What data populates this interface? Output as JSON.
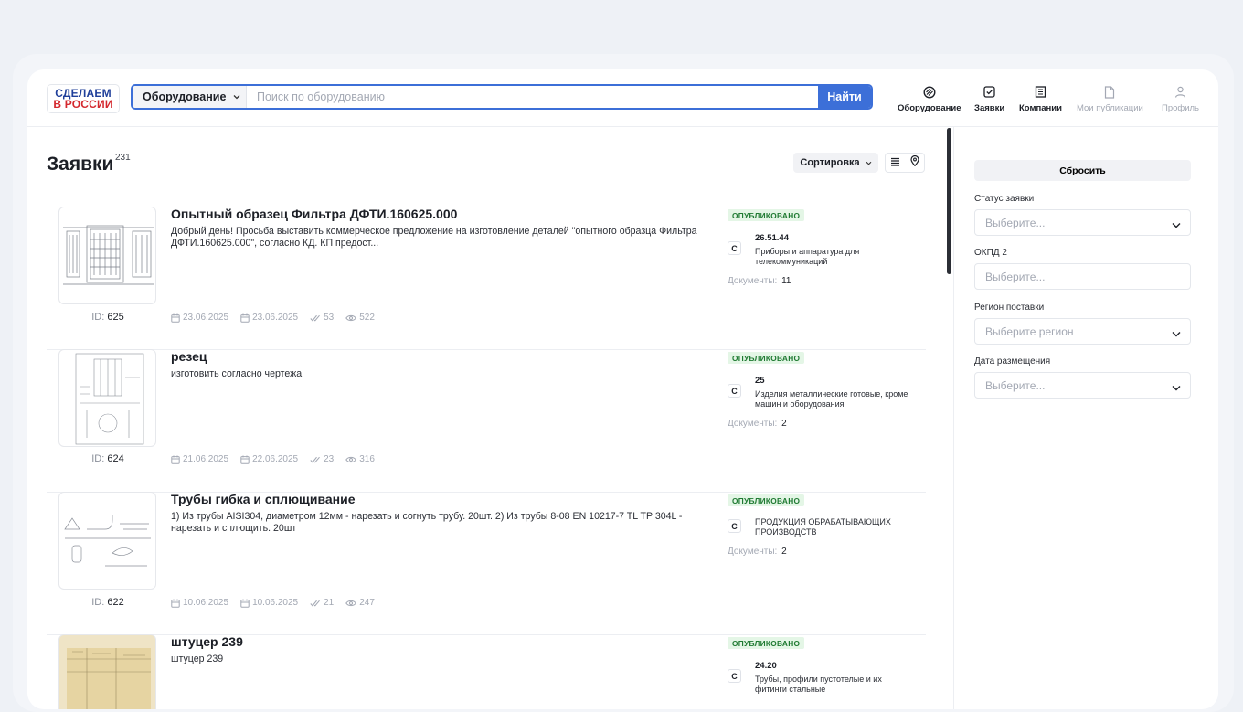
{
  "brand": {
    "line1": "СДЕЛАЕМ",
    "line2": "В РОССИИ"
  },
  "search": {
    "category": "Оборудование",
    "placeholder": "Поиск по оборудованию",
    "button": "Найти"
  },
  "nav": [
    {
      "label": "Оборудование",
      "icon": "equipment-icon",
      "state": "active"
    },
    {
      "label": "Заявки",
      "icon": "requests-icon",
      "state": "active"
    },
    {
      "label": "Компании",
      "icon": "companies-icon",
      "state": "active"
    },
    {
      "label": "Мои публикации",
      "icon": "publications-icon",
      "state": "dim"
    },
    {
      "label": "Профиль",
      "icon": "profile-icon",
      "state": "dim"
    }
  ],
  "page": {
    "title": "Заявки",
    "count": "231",
    "sort_label": "Сортировка"
  },
  "items": [
    {
      "title": "Опытный образец Фильтра ДФТИ.160625.000",
      "description": "Добрый день! Просьба выставить коммерческое предложение на изготовление деталей \"опытного образца Фильтра ДФТИ.160625.000\", согласно КД. КП предост...",
      "id_label": "ID:",
      "id": "625",
      "date_created": "23.06.2025",
      "date_updated": "23.06.2025",
      "responses": "53",
      "views": "522",
      "status": "ОПУБЛИКОВАНО",
      "class_letter": "С",
      "code": "26.51.44",
      "category": "Приборы и аппаратура для телекоммуникаций",
      "docs_label": "Документы:",
      "docs_count": "11"
    },
    {
      "title": "резец",
      "description": "изготовить согласно чертежа",
      "id_label": "ID:",
      "id": "624",
      "date_created": "21.06.2025",
      "date_updated": "22.06.2025",
      "responses": "23",
      "views": "316",
      "status": "ОПУБЛИКОВАНО",
      "class_letter": "С",
      "code": "25",
      "category": "Изделия металлические готовые, кроме машин и оборудования",
      "docs_label": "Документы:",
      "docs_count": "2"
    },
    {
      "title": "Трубы гибка и сплющивание",
      "description": "1) Из трубы AISI304, диаметром 12мм - нарезать и согнуть трубу. 20шт. 2) Из трубы 8-08 EN 10217-7 TL TP 304L - нарезать и сплющить. 20шт",
      "id_label": "ID:",
      "id": "622",
      "date_created": "10.06.2025",
      "date_updated": "10.06.2025",
      "responses": "21",
      "views": "247",
      "status": "ОПУБЛИКОВАНО",
      "class_letter": "С",
      "code": "",
      "category": "ПРОДУКЦИЯ ОБРАБАТЫВАЮЩИХ ПРОИЗВОДСТВ",
      "docs_label": "Документы:",
      "docs_count": "2"
    },
    {
      "title": "штуцер 239",
      "description": "штуцер 239",
      "status": "ОПУБЛИКОВАНО",
      "class_letter": "С",
      "code": "24.20",
      "category": "Трубы, профили пустотелые и их фитинги стальные"
    }
  ],
  "filters": {
    "reset": "Сбросить",
    "status_label": "Статус заявки",
    "status_placeholder": "Выберите...",
    "okpd_label": "ОКПД 2",
    "okpd_placeholder": "Выберите...",
    "region_label": "Регион поставки",
    "region_placeholder": "Выберите регион",
    "date_label": "Дата размещения",
    "date_placeholder": "Выберите..."
  }
}
